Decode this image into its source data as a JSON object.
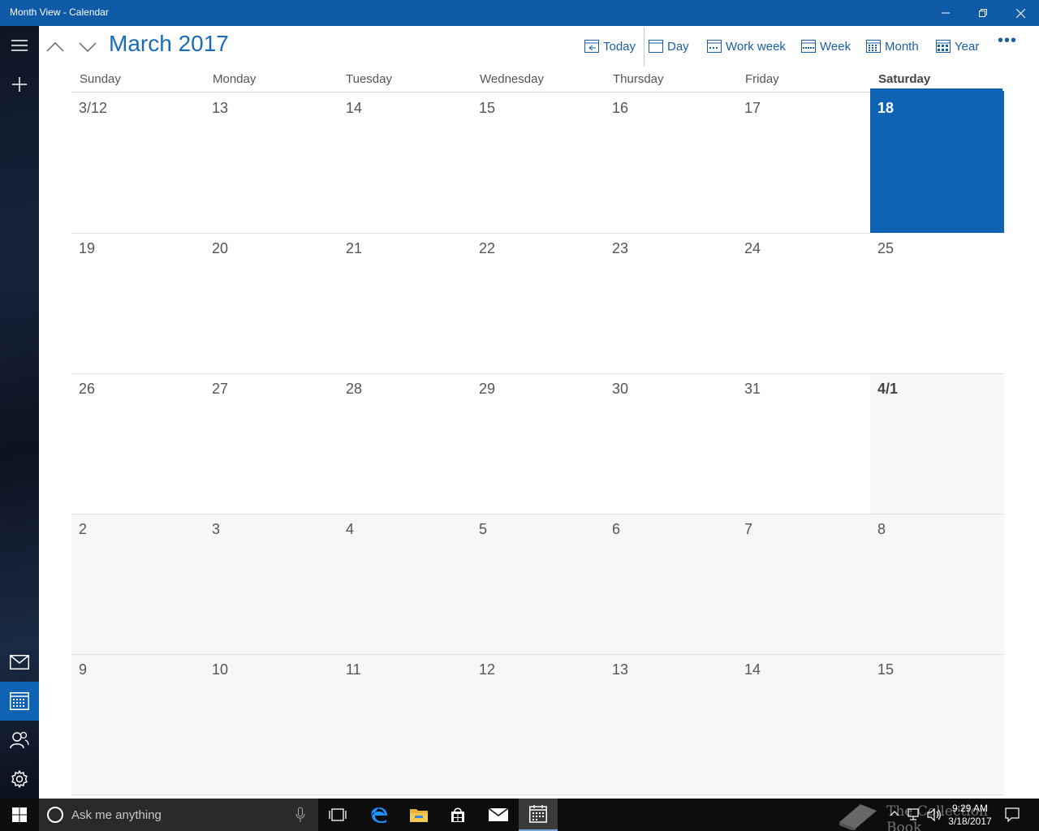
{
  "window": {
    "title": "Month View - Calendar",
    "controls": {
      "minimize": "—",
      "restore": "❐",
      "close": "✕"
    }
  },
  "rail": {
    "items": [
      {
        "icon": "hamburger-icon"
      },
      {
        "icon": "plus-icon"
      },
      {
        "icon": "mail-icon"
      },
      {
        "icon": "calendar-icon",
        "active": true
      },
      {
        "icon": "people-icon"
      },
      {
        "icon": "gear-icon"
      }
    ]
  },
  "header": {
    "title": "March 2017",
    "toolbar": {
      "today": "Today",
      "day": "Day",
      "work_week": "Work week",
      "week": "Week",
      "month": "Month",
      "year": "Year",
      "more": "•••"
    }
  },
  "weekdays": [
    "Sunday",
    "Monday",
    "Tuesday",
    "Wednesday",
    "Thursday",
    "Friday",
    "Saturday"
  ],
  "weeks": [
    [
      {
        "label": "3/12"
      },
      {
        "label": "13"
      },
      {
        "label": "14"
      },
      {
        "label": "15"
      },
      {
        "label": "16"
      },
      {
        "label": "17"
      },
      {
        "label": "18",
        "today": true
      }
    ],
    [
      {
        "label": "19"
      },
      {
        "label": "20"
      },
      {
        "label": "21"
      },
      {
        "label": "22"
      },
      {
        "label": "23"
      },
      {
        "label": "24"
      },
      {
        "label": "25"
      }
    ],
    [
      {
        "label": "26"
      },
      {
        "label": "27"
      },
      {
        "label": "28"
      },
      {
        "label": "29"
      },
      {
        "label": "30"
      },
      {
        "label": "31"
      },
      {
        "label": "4/1",
        "other": true,
        "bold": true
      }
    ],
    [
      {
        "label": "2",
        "other": true
      },
      {
        "label": "3",
        "other": true
      },
      {
        "label": "4",
        "other": true
      },
      {
        "label": "5",
        "other": true
      },
      {
        "label": "6",
        "other": true
      },
      {
        "label": "7",
        "other": true
      },
      {
        "label": "8",
        "other": true
      }
    ],
    [
      {
        "label": "9",
        "other": true
      },
      {
        "label": "10",
        "other": true
      },
      {
        "label": "11",
        "other": true
      },
      {
        "label": "12",
        "other": true
      },
      {
        "label": "13",
        "other": true
      },
      {
        "label": "14",
        "other": true
      },
      {
        "label": "15",
        "other": true
      }
    ]
  ],
  "taskbar": {
    "search_placeholder": "Ask me anything",
    "time": "9:29 AM",
    "date": "3/18/2017",
    "watermark": "The Collection Book"
  },
  "colors": {
    "accent": "#0e63b5",
    "titlebar": "#0e5aa7",
    "link": "#1a5ea6"
  }
}
